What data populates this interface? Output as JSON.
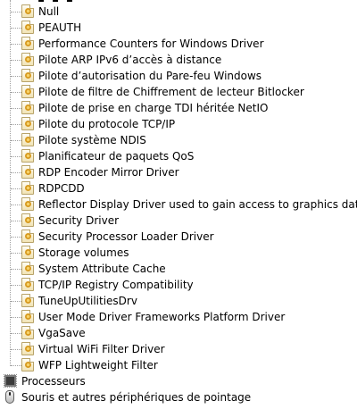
{
  "device_tree": {
    "drivers": [
      "Null",
      "PEAUTH",
      "Performance Counters for Windows Driver",
      "Pilote ARP IPv6 d’accès à distance",
      "Pilote d’autorisation du Pare-feu Windows",
      "Pilote de filtre de Chiffrement de lecteur Bitlocker",
      "Pilote de prise en charge TDI héritée NetIO",
      "Pilote du protocole TCP/IP",
      "Pilote système NDIS",
      "Planificateur de paquets QoS",
      "RDP Encoder Mirror Driver",
      "RDPCDD",
      "Reflector Display Driver used to gain access to graphics data",
      "Security Driver",
      "Security Processor Loader Driver",
      "Storage volumes",
      "System Attribute Cache",
      "TCP/IP Registry Compatibility",
      "TuneUpUtilitiesDrv",
      "User Mode Driver Frameworks Platform Driver",
      "VgaSave",
      "Virtual WiFi Filter Driver",
      "WFP Lightweight Filter"
    ],
    "categories": [
      {
        "label": "Processeurs",
        "icon": "processor-icon"
      },
      {
        "label": "Souris et autres périphériques de pointage",
        "icon": "mouse-icon"
      }
    ],
    "driver_icon": "device-driver-icon",
    "colors": {
      "connector": "#a0a0a0",
      "icon_accent": "#d79a20"
    }
  }
}
